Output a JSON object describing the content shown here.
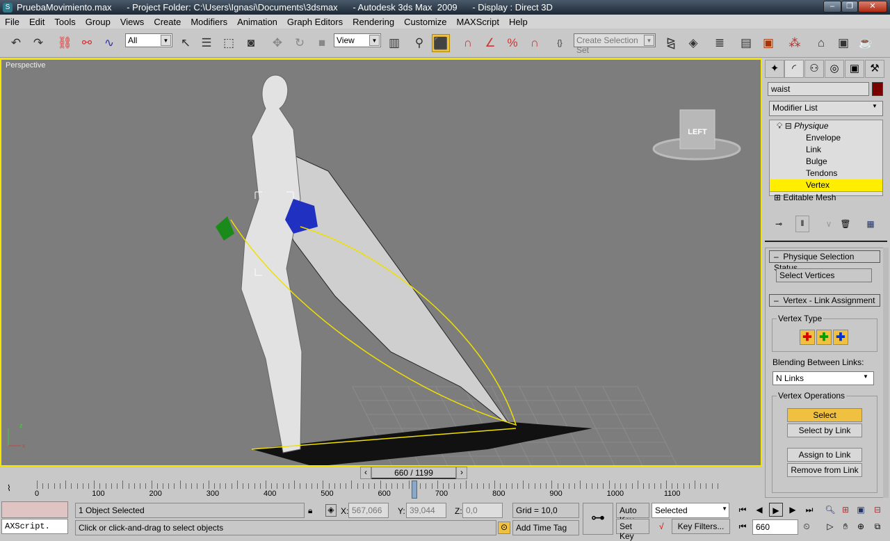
{
  "window": {
    "title": "PruebaMovimiento.max      - Project Folder: C:\\Users\\Ignasi\\Documents\\3dsmax      - Autodesk 3ds Max  2009      - Display : Direct 3D",
    "app_icon": "3dsmax-icon"
  },
  "menu": [
    "File",
    "Edit",
    "Tools",
    "Group",
    "Views",
    "Create",
    "Modifiers",
    "Animation",
    "Graph Editors",
    "Rendering",
    "Customize",
    "MAXScript",
    "Help"
  ],
  "toolbar": {
    "selection_filter": "All",
    "ref_coord": "View",
    "named_selection_placeholder": "Create Selection Set"
  },
  "viewport": {
    "label": "Perspective",
    "viewcube_label": "LEFT",
    "axis_z": "z",
    "axis_x": "x"
  },
  "command_panel": {
    "object_name": "waist",
    "object_color": "#7a0000",
    "modifier_list": "Modifier List",
    "stack": [
      {
        "label": "Physique",
        "level": 0
      },
      {
        "label": "Envelope",
        "level": 1
      },
      {
        "label": "Link",
        "level": 1
      },
      {
        "label": "Bulge",
        "level": 1
      },
      {
        "label": "Tendons",
        "level": 1
      },
      {
        "label": "Vertex",
        "level": 1,
        "selected": true
      },
      {
        "label": "Editable Mesh",
        "level": 0
      }
    ],
    "physique_status_title": "Physique Selection Status",
    "physique_status_value": "Select Vertices",
    "link_assignment_title": "Vertex - Link Assignment",
    "vertex_type_label": "Vertex Type",
    "vertex_type_colors": [
      "#e00000",
      "#00a000",
      "#0030e0"
    ],
    "blending_label": "Blending Between Links:",
    "blending_value": "N Links",
    "vertex_ops_label": "Vertex Operations",
    "buttons": {
      "select": "Select",
      "select_by_link": "Select by Link",
      "assign_to_link": "Assign to Link",
      "remove_from_link": "Remove from Link"
    }
  },
  "timeline": {
    "frame": "660 / 1199",
    "current_frame": 660,
    "total_frames": 1199,
    "ticks": [
      "0",
      "100",
      "200",
      "300",
      "400",
      "500",
      "600",
      "700",
      "800",
      "900",
      "1000",
      "1100"
    ]
  },
  "status": {
    "maxscript": "AXScript.",
    "selected": "1 Object Selected",
    "prompt": "Click or click-and-drag to select objects",
    "x_label": "X:",
    "x": "567,066",
    "y_label": "Y:",
    "y": "39,044",
    "z_label": "Z:",
    "z": "0,0",
    "grid": "Grid = 10,0",
    "add_time_tag": "Add Time Tag",
    "auto_key": "Auto Key",
    "set_key": "Set Key",
    "key_mode": "Selected",
    "key_filters": "Key Filters...",
    "frame_field": "660"
  }
}
